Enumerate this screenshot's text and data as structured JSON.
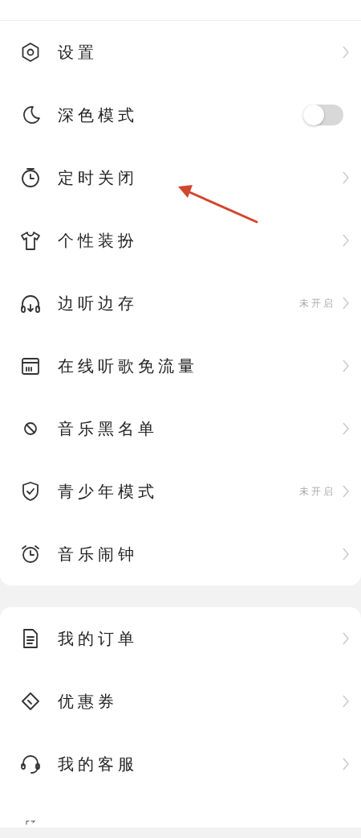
{
  "sections": [
    {
      "items": [
        {
          "kind": "link",
          "label": "设置"
        },
        {
          "kind": "toggle",
          "label": "深色模式",
          "on": false
        },
        {
          "kind": "link",
          "label": "定时关闭"
        },
        {
          "kind": "link",
          "label": "个性装扮"
        },
        {
          "kind": "link",
          "label": "边听边存",
          "status": "未开启"
        },
        {
          "kind": "link",
          "label": "在线听歌免流量"
        },
        {
          "kind": "link",
          "label": "音乐黑名单"
        },
        {
          "kind": "link",
          "label": "青少年模式",
          "status": "未开启"
        },
        {
          "kind": "link",
          "label": "音乐闹钟"
        }
      ]
    },
    {
      "items": [
        {
          "kind": "link",
          "label": "我的订单"
        },
        {
          "kind": "link",
          "label": "优惠券"
        },
        {
          "kind": "link",
          "label": "我的客服"
        }
      ]
    }
  ]
}
